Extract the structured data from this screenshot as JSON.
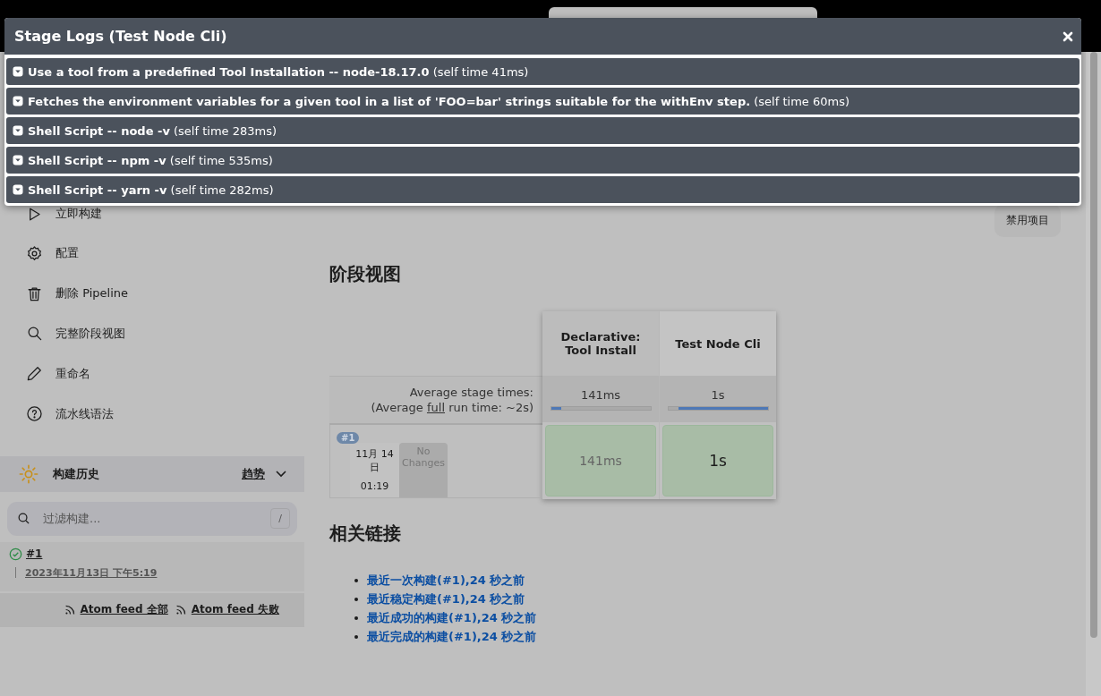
{
  "sidebar": {
    "tasks": [
      {
        "label": "立即构建"
      },
      {
        "label": "配置"
      },
      {
        "label": "删除 Pipeline"
      },
      {
        "label": "完整阶段视图"
      },
      {
        "label": "重命名"
      },
      {
        "label": "流水线语法"
      }
    ],
    "build_history": {
      "title": "构建历史",
      "trend": "趋势",
      "filter": {
        "placeholder": "过滤构建...",
        "shortcut": "/"
      },
      "builds": [
        {
          "number": "#1",
          "date": "2023年11月13日 下午5:19"
        }
      ],
      "feeds": [
        "Atom feed 全部",
        "Atom feed 失败"
      ]
    }
  },
  "main": {
    "disable_button": "禁用项目",
    "stage_view": {
      "title": "阶段视图",
      "average_label": "Average stage times:",
      "full_run_prefix": "(Average ",
      "full_run_link": "full",
      "full_run_suffix": " run time: ~2s)",
      "stages": [
        {
          "name": "Declarative: Tool Install",
          "average": "141ms",
          "level": 0.1
        },
        {
          "name": "Test Node Cli",
          "average": "1s",
          "level": 0.9
        }
      ],
      "runs": [
        {
          "badge": "#1",
          "date": "11月 14 日",
          "time": "01:19",
          "changes": "No Changes",
          "cells": [
            "141ms",
            "1s"
          ]
        }
      ]
    },
    "related_links": {
      "title": "相关链接",
      "links": [
        "最近一次构建(#1),24 秒之前",
        "最近稳定构建(#1),24 秒之前",
        "最近成功的构建(#1),24 秒之前",
        "最近完成的构建(#1),24 秒之前"
      ]
    }
  },
  "modal": {
    "title": "Stage Logs (Test Node Cli)",
    "steps": [
      {
        "title": "Use a tool from a predefined Tool Installation -- node-18.17.0",
        "time": "(self time 41ms)"
      },
      {
        "title": "Fetches the environment variables for a given tool in a list of 'FOO=bar' strings suitable for the withEnv step.",
        "time": "(self time 60ms)"
      },
      {
        "title": "Shell Script -- node -v",
        "time": "(self time 283ms)"
      },
      {
        "title": "Shell Script -- npm -v",
        "time": "(self time 535ms)"
      },
      {
        "title": "Shell Script -- yarn -v",
        "time": "(self time 282ms)"
      }
    ]
  }
}
